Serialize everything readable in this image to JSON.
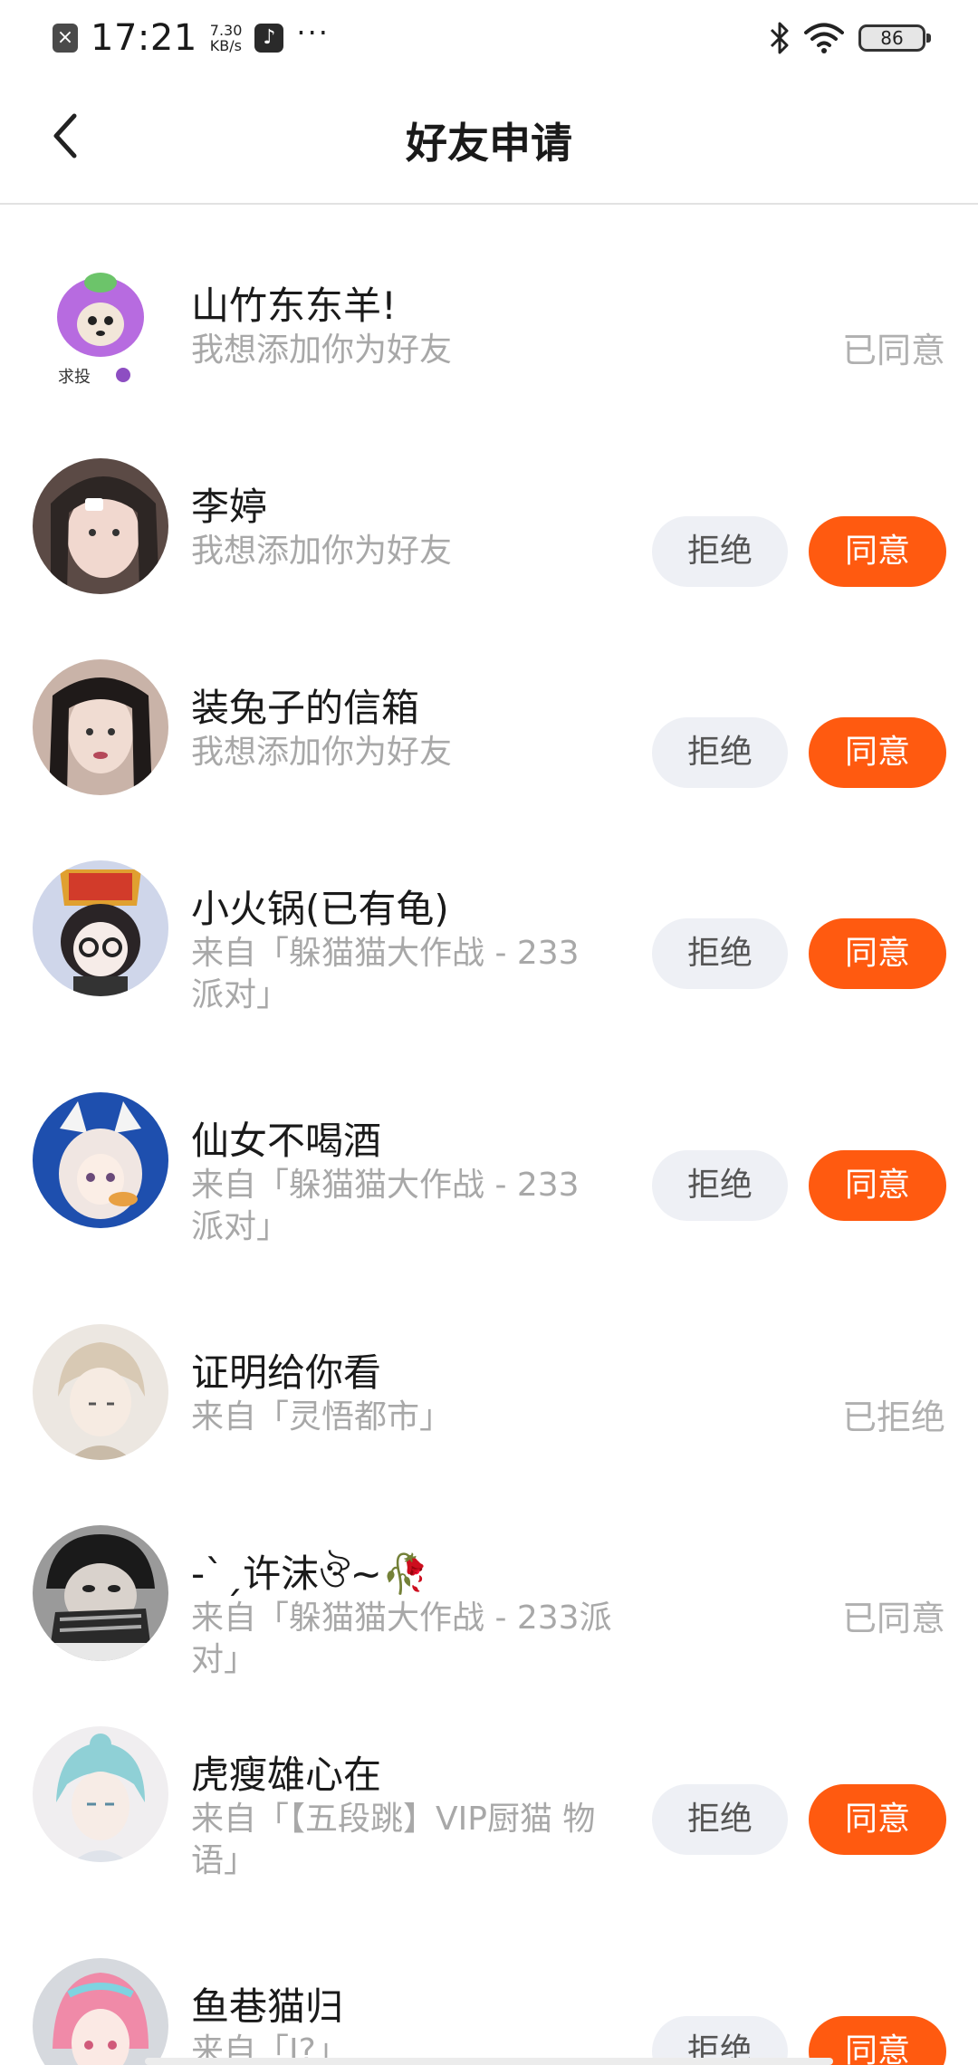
{
  "status_bar": {
    "time": "17:21",
    "speed_value": "7.30",
    "speed_unit": "KB/s",
    "battery": "86",
    "more": "···"
  },
  "header": {
    "title": "好友申请"
  },
  "buttons": {
    "reject": "拒绝",
    "accept": "同意"
  },
  "requests": [
    {
      "name": "山竹东东羊!",
      "note": "我想添加你为好友",
      "state": "已同意"
    },
    {
      "name": "李婷",
      "note": "我想添加你为好友",
      "state": "pending"
    },
    {
      "name": "装兔子的信箱",
      "note": "我想添加你为好友",
      "state": "pending"
    },
    {
      "name": "小火锅(已有龟)",
      "note": "来自「躲猫猫大作战 - 233 派对」",
      "state": "pending"
    },
    {
      "name": "仙女不喝酒",
      "note": "来自「躲猫猫大作战 - 233 派对」",
      "state": "pending"
    },
    {
      "name": "证明给你看",
      "note": "来自「灵悟都市」",
      "state": "已拒绝"
    },
    {
      "name": "-ˋˏ许沫ঔ~🥀",
      "note": "来自「躲猫猫大作战 - 233派对」",
      "state": "已同意"
    },
    {
      "name": "虎瘦雄心在",
      "note": "来自「【五段跳】VIP厨猫 物语」",
      "state": "pending"
    },
    {
      "name": "鱼巷猫归",
      "note": "来自「I?」",
      "state": "pending"
    }
  ],
  "colors": {
    "accent": "#ff5a10",
    "reject_bg": "#eef0f5",
    "muted_text": "#a8a8a8"
  }
}
